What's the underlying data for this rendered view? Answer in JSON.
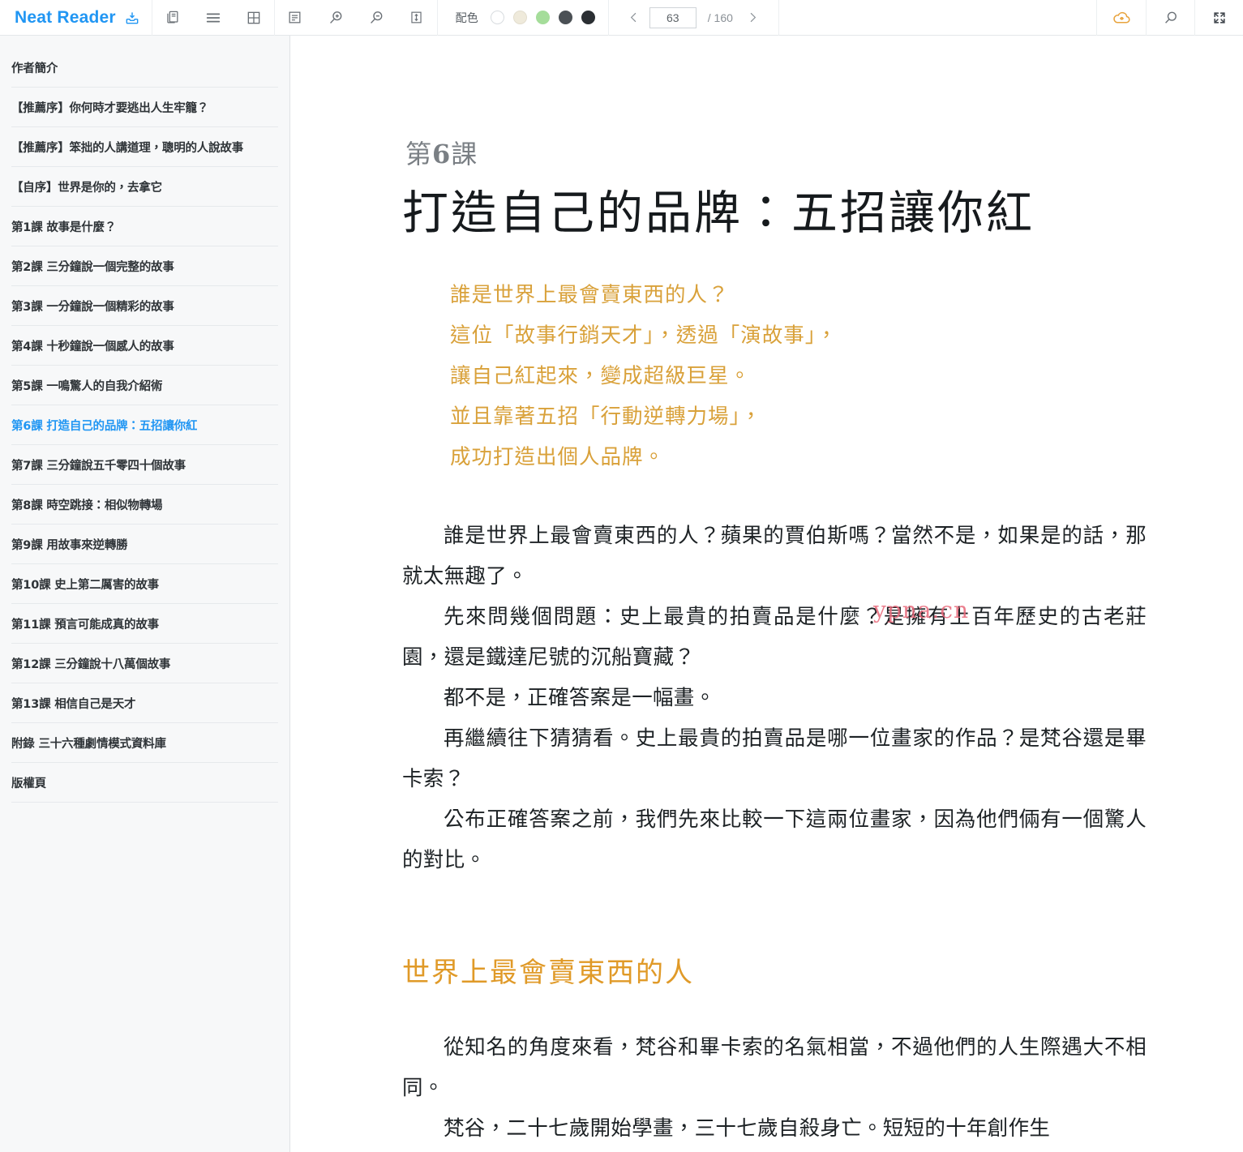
{
  "app": {
    "brand": "Neat Reader"
  },
  "toolbar": {
    "icons": {
      "import": "import-tray-icon",
      "library": "library-copy-icon",
      "single_column": "single-column-icon",
      "double_column": "double-column-icon",
      "text_settings": "text-settings-icon",
      "zoom_in": "zoom-in-icon",
      "zoom_out": "zoom-out-icon",
      "line_height": "line-height-icon",
      "prev_page": "chevron-left-icon",
      "next_page": "chevron-right-icon",
      "cloud_sync": "cloud-sync-icon",
      "search": "search-icon",
      "fullscreen": "fullscreen-icon"
    },
    "palette": {
      "label": "配色",
      "swatches": [
        {
          "name": "white",
          "color": "#ffffff",
          "border": "#d8dcdf",
          "selected": false
        },
        {
          "name": "cream",
          "color": "#efeadb",
          "border": "#e2ddce",
          "selected": false
        },
        {
          "name": "green",
          "color": "#a5dd9a",
          "border": "#a5dd9a",
          "selected": false
        },
        {
          "name": "gray",
          "color": "#4b5055",
          "border": "#4b5055",
          "selected": false
        },
        {
          "name": "black",
          "color": "#2b2f33",
          "border": "#2b2f33",
          "selected": false
        }
      ]
    },
    "pager": {
      "current": "63",
      "separator": "/ 160",
      "total": "160"
    },
    "brand_color": "#2196f3",
    "cloud_color": "#e8a33d"
  },
  "sidebar": {
    "items": [
      {
        "label": "作者簡介",
        "active": false
      },
      {
        "label": "【推薦序】你何時才要逃出人生牢籠？",
        "active": false
      },
      {
        "label": "【推薦序】笨拙的人講道理，聰明的人說故事",
        "active": false
      },
      {
        "label": "【自序】世界是你的，去拿它",
        "active": false
      },
      {
        "label": "第1課 故事是什麼？",
        "active": false
      },
      {
        "label": "第2課 三分鐘說一個完整的故事",
        "active": false
      },
      {
        "label": "第3課 一分鐘說一個精彩的故事",
        "active": false
      },
      {
        "label": "第4課 十秒鐘說一個感人的故事",
        "active": false
      },
      {
        "label": "第5課 一鳴驚人的自我介紹術",
        "active": false
      },
      {
        "label": "第6課 打造自己的品牌：五招讓你紅",
        "active": true
      },
      {
        "label": "第7課 三分鐘說五千零四十個故事",
        "active": false
      },
      {
        "label": "第8課 時空跳接：相似物轉場",
        "active": false
      },
      {
        "label": "第9課 用故事來逆轉勝",
        "active": false
      },
      {
        "label": "第10課 史上第二厲害的故事",
        "active": false
      },
      {
        "label": "第11課 預言可能成真的故事",
        "active": false
      },
      {
        "label": "第12課 三分鐘說十八萬個故事",
        "active": false
      },
      {
        "label": "第13課 相信自己是天才",
        "active": false
      },
      {
        "label": "附錄 三十六種劇情模式資料庫",
        "active": false
      },
      {
        "label": "版權頁",
        "active": false
      }
    ],
    "active_color": "#2196f3"
  },
  "content": {
    "chapter_label_prefix": "第",
    "chapter_label_number": "6",
    "chapter_label_suffix": "課",
    "chapter_title": "打造自己的品牌：五招讓你紅",
    "lead_color": "#d9a13a",
    "lead_lines": [
      "誰是世界上最會賣東西的人？",
      "這位「故事行銷天才」，透過「演故事」，",
      "讓自己紅起來，變成超級巨星。",
      "並且靠著五招「行動逆轉力場」，",
      "成功打造出個人品牌。"
    ],
    "paragraphs_before_heading": [
      "誰是世界上最會賣東西的人？蘋果的賈伯斯嗎？當然不是，如果是的話，那就太無趣了。",
      "先來問幾個問題：史上最貴的拍賣品是什麼？是擁有上百年歷史的古老莊園，還是鐵達尼號的沉船寶藏？",
      "都不是，正確答案是一幅畫。",
      "再繼續往下猜猜看。史上最貴的拍賣品是哪一位畫家的作品？是梵谷還是畢卡索？",
      "公布正確答案之前，我們先來比較一下這兩位畫家，因為他們倆有一個驚人的對比。"
    ],
    "section_heading": "世界上最會賣東西的人",
    "section_heading_color": "#e09a28",
    "paragraphs_after_heading": [
      "從知名的角度來看，梵谷和畢卡索的名氣相當，不過他們的人生際遇大不相同。",
      "梵谷，二十七歲開始學畫，三十七歲自殺身亡。短短的十年創作生"
    ],
    "watermark": "ypna.cn",
    "watermark_color": "#e8687a"
  }
}
